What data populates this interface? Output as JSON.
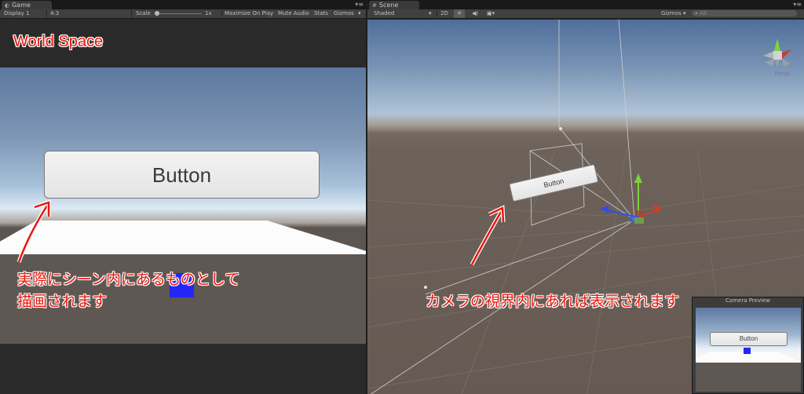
{
  "game_panel": {
    "tab_label": "Game",
    "toolbar": {
      "display": "Display 1",
      "aspect": "4:3",
      "scale_label": "Scale",
      "scale_value": "1x",
      "maximize": "Maximize On Play",
      "mute": "Mute Audio",
      "stats": "Stats",
      "gizmos": "Gizmos"
    },
    "button_label": "Button",
    "annotation_title": "World Space",
    "caption_line1": "実際にシーン内にあるものとして",
    "caption_line2": "描画されます"
  },
  "scene_panel": {
    "tab_label": "Scene",
    "toolbar": {
      "shading": "Shaded",
      "mode_2d": "2D",
      "gizmos": "Gizmos",
      "search_placeholder": "All"
    },
    "persp_label": "Persp",
    "button_label": "Button",
    "caption": "カメラの視界内にあれば表示されます",
    "camera_preview": {
      "title": "Camera Preview",
      "button_label": "Button"
    }
  },
  "colors": {
    "annotation_red": "#e8140a",
    "cube_blue": "#2326f5",
    "axis_red": "#d23a2a",
    "axis_green": "#7bd43a",
    "axis_blue": "#2b50e6"
  }
}
